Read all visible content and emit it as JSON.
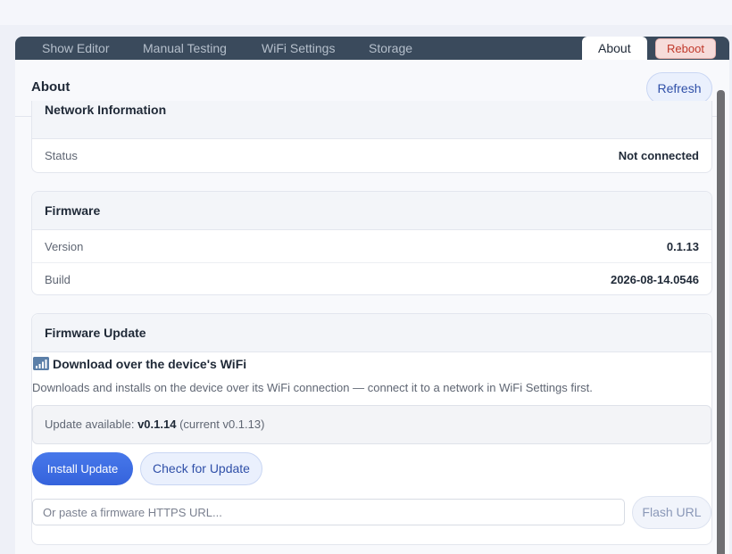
{
  "tabs": [
    {
      "label": "Show Editor"
    },
    {
      "label": "Manual Testing"
    },
    {
      "label": "WiFi Settings"
    },
    {
      "label": "Storage"
    },
    {
      "label": "About"
    }
  ],
  "reboot_label": "Reboot",
  "header": {
    "title": "About",
    "refresh_label": "Refresh"
  },
  "network": {
    "title": "Network Information",
    "rows": [
      {
        "key": "Status",
        "value": "Not connected"
      }
    ]
  },
  "firmware": {
    "title": "Firmware",
    "rows": [
      {
        "key": "Version",
        "value": "0.1.13"
      },
      {
        "key": "Build",
        "value": "2026-08-14.0546"
      }
    ]
  },
  "update": {
    "title": "Firmware Update",
    "wifi_icon": "signal-bars-icon",
    "download_title": "Download over the device's WiFi",
    "download_desc": "Downloads and installs on the device over its WiFi connection — connect it to a network in WiFi Settings first.",
    "available_prefix": "Update available: ",
    "available_version": "v0.1.14",
    "available_suffix": " (current v0.1.13)",
    "install_label": "Install Update",
    "check_label": "Check for Update",
    "url_placeholder": "Or paste a firmware HTTPS URL...",
    "flash_label": "Flash URL"
  },
  "colors": {
    "tabbar": "#3a4a5c",
    "primary": "#3563dc",
    "danger": "#c0392b"
  }
}
